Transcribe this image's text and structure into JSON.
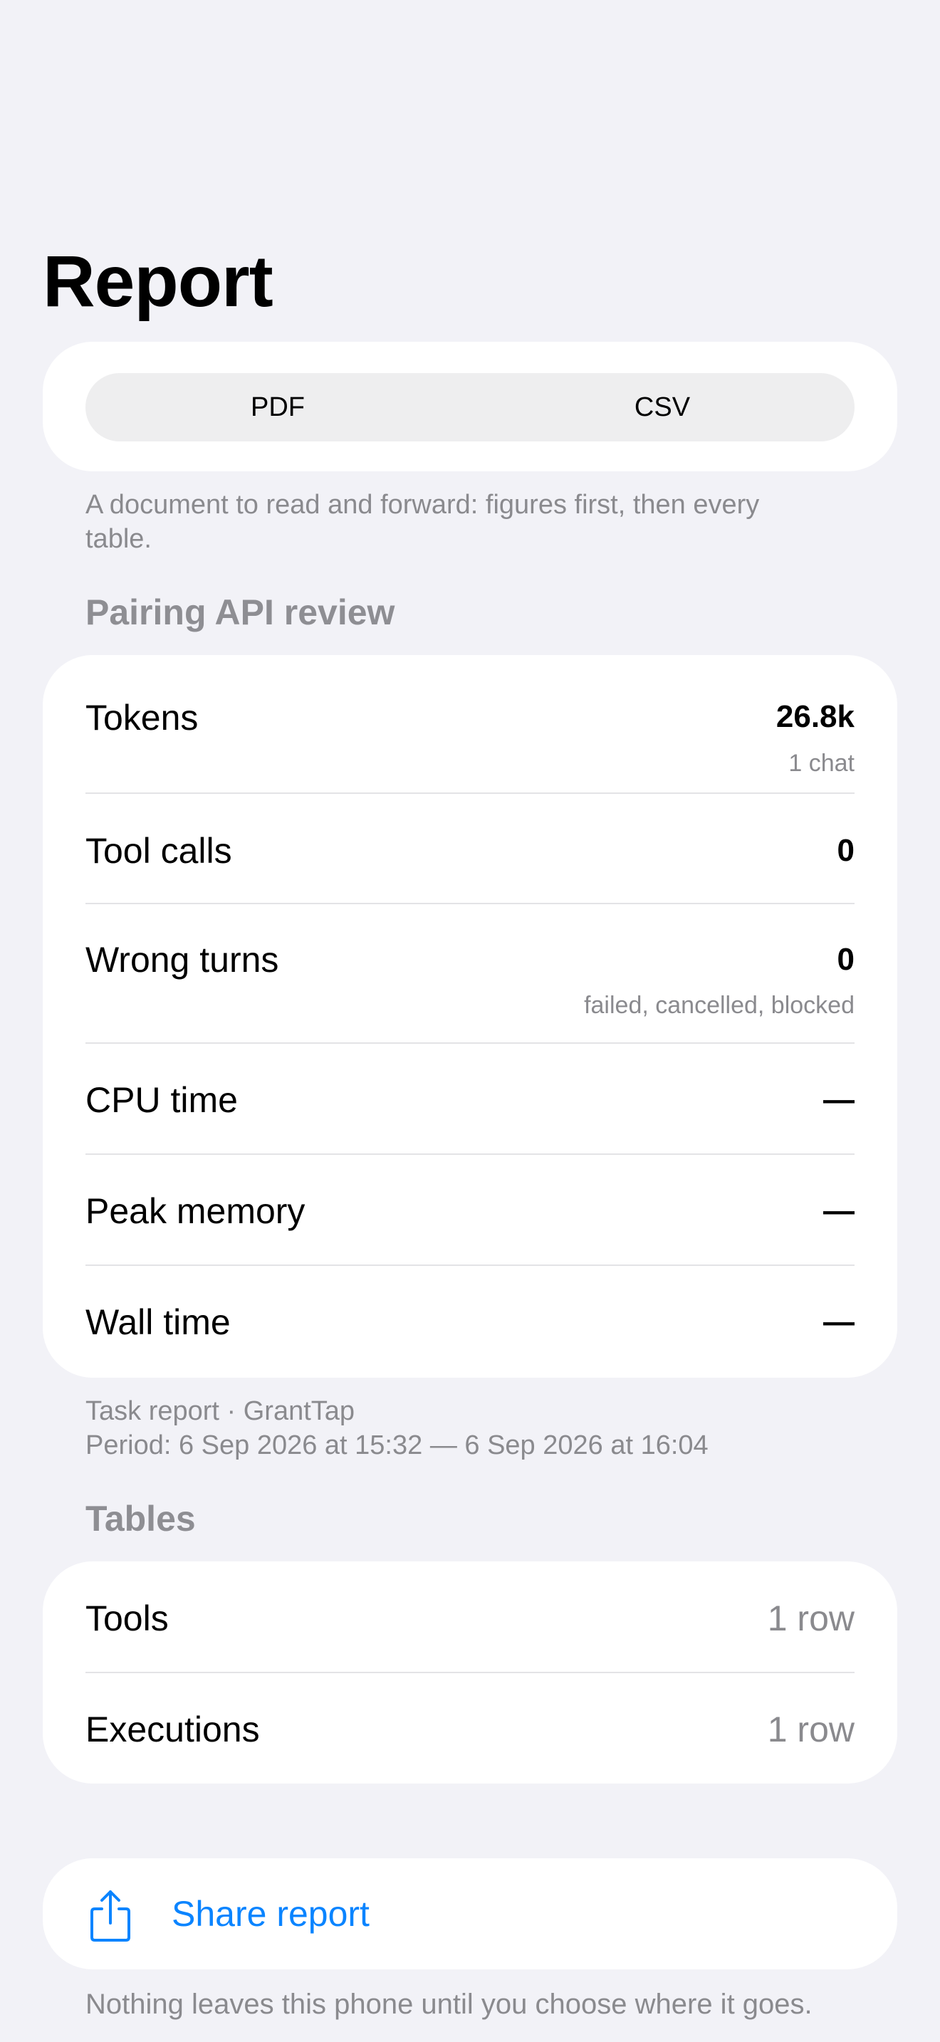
{
  "page": {
    "title": "Report"
  },
  "format": {
    "options": [
      "PDF",
      "CSV"
    ],
    "caption": "A document to read and forward: figures first, then every table."
  },
  "summary": {
    "header": "Pairing API review",
    "rows": [
      {
        "label": "Tokens",
        "value": "26.8k",
        "sub": "1 chat"
      },
      {
        "label": "Tool calls",
        "value": "0",
        "sub": ""
      },
      {
        "label": "Wrong turns",
        "value": "0",
        "sub": "failed, cancelled, blocked"
      },
      {
        "label": "CPU time",
        "value": "—",
        "sub": ""
      },
      {
        "label": "Peak memory",
        "value": "—",
        "sub": ""
      },
      {
        "label": "Wall time",
        "value": "—",
        "sub": ""
      }
    ],
    "caption_line1": "Task report · GrantTap",
    "caption_line2": "Period: 6 Sep 2026 at 15:32 — 6 Sep 2026 at 16:04"
  },
  "tables": {
    "header": "Tables",
    "rows": [
      {
        "label": "Tools",
        "value": "1 row"
      },
      {
        "label": "Executions",
        "value": "1 row"
      }
    ]
  },
  "share": {
    "label": "Share report",
    "icon": "share-icon",
    "accent": "#0a84ff",
    "footer": "Nothing leaves this phone until you choose where it goes."
  }
}
